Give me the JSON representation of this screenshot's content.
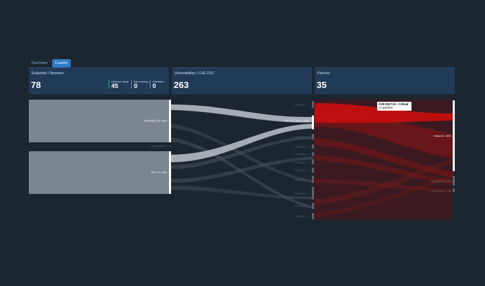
{
  "tabs": [
    {
      "label": "Overview",
      "active": false
    },
    {
      "label": "Custom",
      "active": true
    }
  ],
  "panels": {
    "endpoints": {
      "title": "Endpoints / Windows",
      "value": "78",
      "stats": [
        {
          "label": "Antivirus okay",
          "value": "45",
          "color": "#2fb37b"
        },
        {
          "label": "Not running",
          "value": "0",
          "color": "#d64fa8"
        },
        {
          "label": "Outdated",
          "value": "0",
          "color": "#4fa3e0"
        }
      ]
    },
    "vulnerabilities": {
      "title": "Vulnerabilities / CVE-2017",
      "value": "263"
    },
    "patches": {
      "title": "Patches",
      "value": "35"
    }
  },
  "sankey": {
    "endpoint_nodes": [
      {
        "label": "Win2008R2 63 / 81%",
        "highlight": true
      },
      {
        "label": "Win2008R2 1 / 1%",
        "highlight": false
      },
      {
        "label": "Win7 14 / 18%",
        "highlight": true
      }
    ],
    "vulnerability_nodes": [
      {
        "label": "CVE-2017-...",
        "highlight": false
      },
      {
        "label": "CVE-2017-01 12 / 38%",
        "highlight": true
      },
      {
        "label": "CVE-2017-...",
        "highlight": false
      },
      {
        "label": "CVE-2017-...",
        "highlight": false
      },
      {
        "label": "CVE-2017-...",
        "highlight": false
      },
      {
        "label": "CVE-2017-...",
        "highlight": false
      },
      {
        "label": "CVE-2017-...",
        "highlight": false
      },
      {
        "label": "CVE-2017-...",
        "highlight": false
      },
      {
        "label": "CVE-2017-...",
        "highlight": false
      },
      {
        "label": "CVE-2017-...",
        "highlight": false
      },
      {
        "label": "CVE-2017-...",
        "highlight": false
      },
      {
        "label": "CVE-2017-...",
        "highlight": false
      }
    ],
    "patch_nodes": [
      {
        "label": "Critical 21 / 60%",
        "highlight": true
      },
      {
        "label": "Important 13 / 38%",
        "highlight": false
      },
      {
        "label": "Unspecified 1 / 3%",
        "highlight": false
      }
    ]
  },
  "tooltip": {
    "title": "CVE-2017-01 - Critical",
    "subtitle": "17 patches"
  },
  "colors": {
    "background": "#1c2631",
    "panel": "#213a57",
    "node_gray": "#7c8690",
    "flow_highlight": "#bcc3ca",
    "flow_red": "#b01010",
    "patch_bg": "#3a1a20"
  }
}
